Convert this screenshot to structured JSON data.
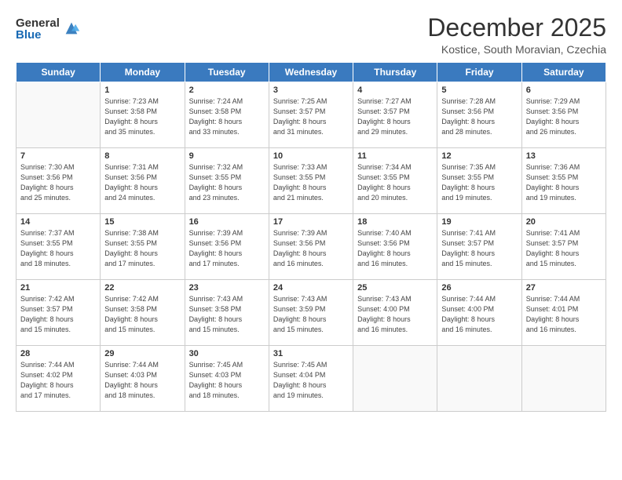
{
  "logo": {
    "general": "General",
    "blue": "Blue"
  },
  "header": {
    "month_title": "December 2025",
    "location": "Kostice, South Moravian, Czechia"
  },
  "weekdays": [
    "Sunday",
    "Monday",
    "Tuesday",
    "Wednesday",
    "Thursday",
    "Friday",
    "Saturday"
  ],
  "weeks": [
    [
      {
        "day": "",
        "info": ""
      },
      {
        "day": "1",
        "info": "Sunrise: 7:23 AM\nSunset: 3:58 PM\nDaylight: 8 hours\nand 35 minutes."
      },
      {
        "day": "2",
        "info": "Sunrise: 7:24 AM\nSunset: 3:58 PM\nDaylight: 8 hours\nand 33 minutes."
      },
      {
        "day": "3",
        "info": "Sunrise: 7:25 AM\nSunset: 3:57 PM\nDaylight: 8 hours\nand 31 minutes."
      },
      {
        "day": "4",
        "info": "Sunrise: 7:27 AM\nSunset: 3:57 PM\nDaylight: 8 hours\nand 29 minutes."
      },
      {
        "day": "5",
        "info": "Sunrise: 7:28 AM\nSunset: 3:56 PM\nDaylight: 8 hours\nand 28 minutes."
      },
      {
        "day": "6",
        "info": "Sunrise: 7:29 AM\nSunset: 3:56 PM\nDaylight: 8 hours\nand 26 minutes."
      }
    ],
    [
      {
        "day": "7",
        "info": "Sunrise: 7:30 AM\nSunset: 3:56 PM\nDaylight: 8 hours\nand 25 minutes."
      },
      {
        "day": "8",
        "info": "Sunrise: 7:31 AM\nSunset: 3:56 PM\nDaylight: 8 hours\nand 24 minutes."
      },
      {
        "day": "9",
        "info": "Sunrise: 7:32 AM\nSunset: 3:55 PM\nDaylight: 8 hours\nand 23 minutes."
      },
      {
        "day": "10",
        "info": "Sunrise: 7:33 AM\nSunset: 3:55 PM\nDaylight: 8 hours\nand 21 minutes."
      },
      {
        "day": "11",
        "info": "Sunrise: 7:34 AM\nSunset: 3:55 PM\nDaylight: 8 hours\nand 20 minutes."
      },
      {
        "day": "12",
        "info": "Sunrise: 7:35 AM\nSunset: 3:55 PM\nDaylight: 8 hours\nand 19 minutes."
      },
      {
        "day": "13",
        "info": "Sunrise: 7:36 AM\nSunset: 3:55 PM\nDaylight: 8 hours\nand 19 minutes."
      }
    ],
    [
      {
        "day": "14",
        "info": "Sunrise: 7:37 AM\nSunset: 3:55 PM\nDaylight: 8 hours\nand 18 minutes."
      },
      {
        "day": "15",
        "info": "Sunrise: 7:38 AM\nSunset: 3:55 PM\nDaylight: 8 hours\nand 17 minutes."
      },
      {
        "day": "16",
        "info": "Sunrise: 7:39 AM\nSunset: 3:56 PM\nDaylight: 8 hours\nand 17 minutes."
      },
      {
        "day": "17",
        "info": "Sunrise: 7:39 AM\nSunset: 3:56 PM\nDaylight: 8 hours\nand 16 minutes."
      },
      {
        "day": "18",
        "info": "Sunrise: 7:40 AM\nSunset: 3:56 PM\nDaylight: 8 hours\nand 16 minutes."
      },
      {
        "day": "19",
        "info": "Sunrise: 7:41 AM\nSunset: 3:57 PM\nDaylight: 8 hours\nand 15 minutes."
      },
      {
        "day": "20",
        "info": "Sunrise: 7:41 AM\nSunset: 3:57 PM\nDaylight: 8 hours\nand 15 minutes."
      }
    ],
    [
      {
        "day": "21",
        "info": "Sunrise: 7:42 AM\nSunset: 3:57 PM\nDaylight: 8 hours\nand 15 minutes."
      },
      {
        "day": "22",
        "info": "Sunrise: 7:42 AM\nSunset: 3:58 PM\nDaylight: 8 hours\nand 15 minutes."
      },
      {
        "day": "23",
        "info": "Sunrise: 7:43 AM\nSunset: 3:58 PM\nDaylight: 8 hours\nand 15 minutes."
      },
      {
        "day": "24",
        "info": "Sunrise: 7:43 AM\nSunset: 3:59 PM\nDaylight: 8 hours\nand 15 minutes."
      },
      {
        "day": "25",
        "info": "Sunrise: 7:43 AM\nSunset: 4:00 PM\nDaylight: 8 hours\nand 16 minutes."
      },
      {
        "day": "26",
        "info": "Sunrise: 7:44 AM\nSunset: 4:00 PM\nDaylight: 8 hours\nand 16 minutes."
      },
      {
        "day": "27",
        "info": "Sunrise: 7:44 AM\nSunset: 4:01 PM\nDaylight: 8 hours\nand 16 minutes."
      }
    ],
    [
      {
        "day": "28",
        "info": "Sunrise: 7:44 AM\nSunset: 4:02 PM\nDaylight: 8 hours\nand 17 minutes."
      },
      {
        "day": "29",
        "info": "Sunrise: 7:44 AM\nSunset: 4:03 PM\nDaylight: 8 hours\nand 18 minutes."
      },
      {
        "day": "30",
        "info": "Sunrise: 7:45 AM\nSunset: 4:03 PM\nDaylight: 8 hours\nand 18 minutes."
      },
      {
        "day": "31",
        "info": "Sunrise: 7:45 AM\nSunset: 4:04 PM\nDaylight: 8 hours\nand 19 minutes."
      },
      {
        "day": "",
        "info": ""
      },
      {
        "day": "",
        "info": ""
      },
      {
        "day": "",
        "info": ""
      }
    ]
  ]
}
